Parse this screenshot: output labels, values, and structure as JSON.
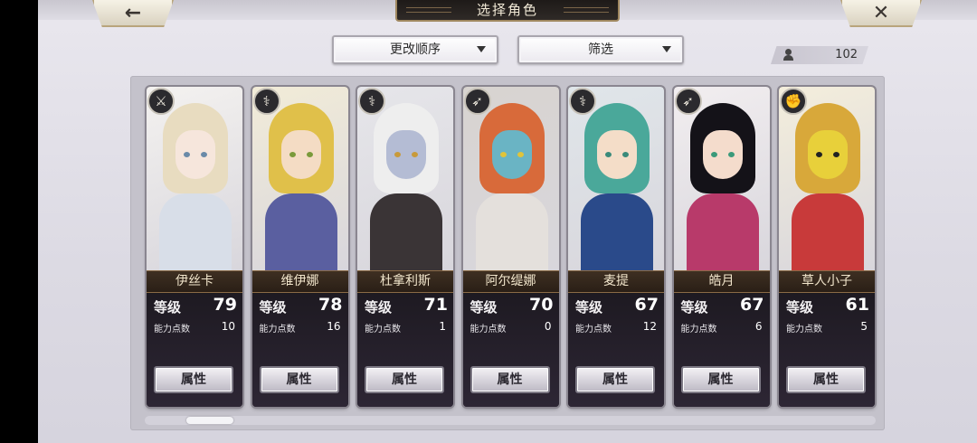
{
  "header": {
    "title": "选择角色",
    "back_icon": "←",
    "close_icon": "✕"
  },
  "controls": {
    "order_label": "更改顺序",
    "filter_label": "筛选",
    "owned_count": "102"
  },
  "characters": [
    {
      "name": "伊丝卡",
      "level_label": "等级",
      "level": "79",
      "points_label": "能力点数",
      "points": "10",
      "attr_label": "属性",
      "class_icon": "sword-icon",
      "glyph": "⚔",
      "hair": "#e8dcc0",
      "skin": "#f6e6dc",
      "outfit": "#d8dee8",
      "eyes": "#6a8aa8",
      "bg": "#f4f2f0"
    },
    {
      "name": "维伊娜",
      "level_label": "等级",
      "level": "78",
      "points_label": "能力点数",
      "points": "16",
      "attr_label": "属性",
      "class_icon": "staff-icon",
      "glyph": "⚕",
      "hair": "#e0c04a",
      "skin": "#f4dcc4",
      "outfit": "#5a5fa0",
      "eyes": "#7a9a3a",
      "bg": "#f2ecd8"
    },
    {
      "name": "杜拿利斯",
      "level_label": "等级",
      "level": "71",
      "points_label": "能力点数",
      "points": "1",
      "attr_label": "属性",
      "class_icon": "staff-icon",
      "glyph": "⚕",
      "hair": "#eeeeee",
      "skin": "#b4bcd4",
      "outfit": "#3a3436",
      "eyes": "#c89a3a",
      "bg": "#e6e6ea"
    },
    {
      "name": "阿尔缇娜",
      "level_label": "等级",
      "level": "70",
      "points_label": "能力点数",
      "points": "0",
      "attr_label": "属性",
      "class_icon": "bow-icon",
      "glyph": "➶",
      "hair": "#d86a3a",
      "skin": "#6ab4c4",
      "outfit": "#e4e0dc",
      "eyes": "#e0c43a",
      "bg": "#d8d4d0"
    },
    {
      "name": "麦提",
      "level_label": "等级",
      "level": "67",
      "points_label": "能力点数",
      "points": "12",
      "attr_label": "属性",
      "class_icon": "staff-icon",
      "glyph": "⚕",
      "hair": "#4aa89a",
      "skin": "#f4ddc8",
      "outfit": "#2a4a8a",
      "eyes": "#3a8a7a",
      "bg": "#e0e6ea"
    },
    {
      "name": "皓月",
      "level_label": "等级",
      "level": "67",
      "points_label": "能力点数",
      "points": "6",
      "attr_label": "属性",
      "class_icon": "bow-icon",
      "glyph": "➶",
      "hair": "#141218",
      "skin": "#f4dccc",
      "outfit": "#b83a6a",
      "eyes": "#3a9a7a",
      "bg": "#f2eef0"
    },
    {
      "name": "草人小子",
      "level_label": "等级",
      "level": "61",
      "points_label": "能力点数",
      "points": "5",
      "attr_label": "属性",
      "class_icon": "fist-icon",
      "glyph": "✊",
      "hair": "#d8a83a",
      "skin": "#e8d03a",
      "outfit": "#c83a3a",
      "eyes": "#222222",
      "bg": "#f4eedc"
    }
  ],
  "colors": {
    "panel": "#c4c2cb",
    "name_plate": "#3e2f22",
    "accent_gold": "#a08860"
  }
}
